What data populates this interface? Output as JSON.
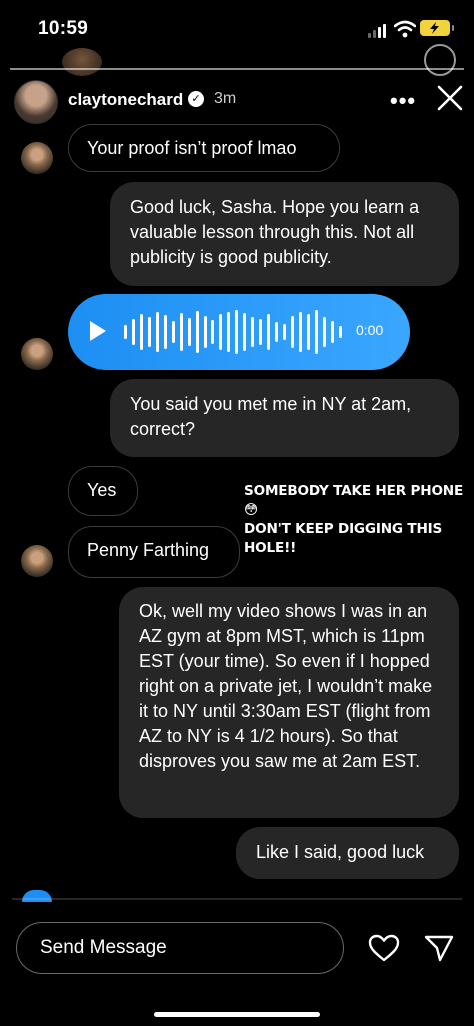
{
  "status_bar": {
    "time": "10:59",
    "battery_charging": true
  },
  "header": {
    "username": "claytonechard",
    "time_ago": "3m",
    "more_glyph": "•••",
    "verified_glyph": "✓"
  },
  "messages": [
    {
      "from": "them",
      "text": "Your proof isn’t proof lmao"
    },
    {
      "from": "me",
      "text": "Good luck, Sasha. Hope you learn a valuable lesson through this. Not all publicity is good publicity."
    },
    {
      "from": "them",
      "type": "voice",
      "duration": "0:00"
    },
    {
      "from": "me",
      "text": "You said you met me in NY at 2am, correct?"
    },
    {
      "from": "them",
      "text": "Yes"
    },
    {
      "from": "them",
      "text": "Penny Farthing"
    },
    {
      "from": "me",
      "text": "Ok, well my video shows I was in an AZ gym at 8pm MST, which is 11pm EST (your time). So even if I hopped right on a private jet, I wouldn’t make it to NY until 3:30am EST (flight from AZ to NY is 4 1/2 hours). So that disproves you saw me at 2am EST."
    },
    {
      "from": "me",
      "text": "Like I said, good luck"
    }
  ],
  "caption": {
    "line1": "SOMEBODY TAKE HER PHONE 😳",
    "line2": "DON'T KEEP DIGGING THIS HOLE!!"
  },
  "composer": {
    "placeholder": "Send Message"
  },
  "colors": {
    "voice_bubble": "#1d8ff3",
    "outgoing_bubble": "#262626",
    "battery": "#f2d33b"
  },
  "icons": [
    "signal-icon",
    "wifi-icon",
    "battery-icon",
    "verified-icon",
    "more-icon",
    "close-icon",
    "play-icon",
    "heart-icon",
    "send-icon"
  ]
}
